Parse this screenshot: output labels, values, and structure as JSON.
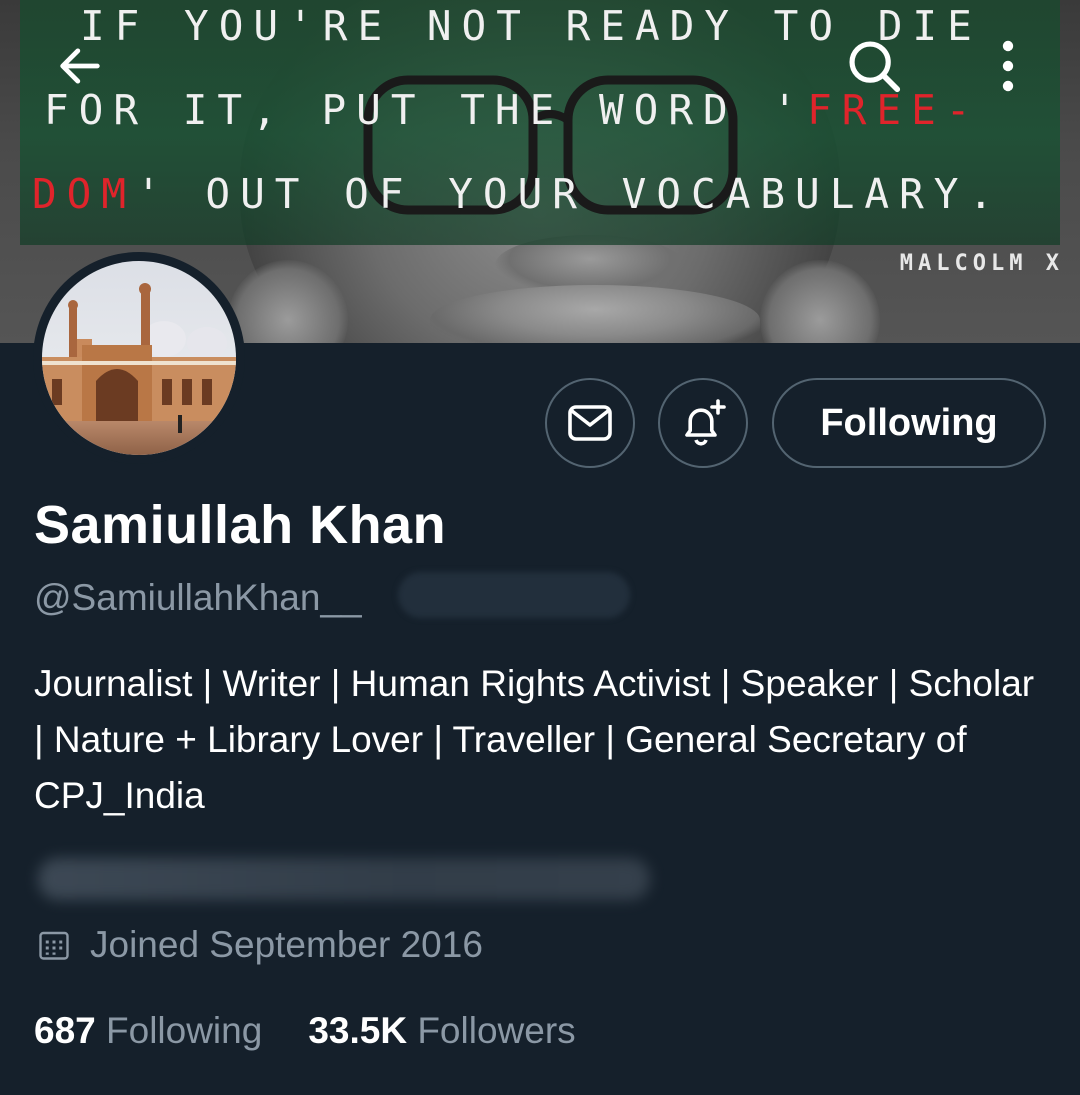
{
  "banner": {
    "quote_line1": "IF YOU'RE NOT READY TO DIE",
    "quote_line2_a": "FOR IT, PUT THE WORD '",
    "quote_line2_b": "FREE-",
    "quote_line3_a": "DOM",
    "quote_line3_b": "' OUT OF YOUR VOCABULARY.",
    "attribution": "MALCOLM X",
    "highlight_color": "#e0242b"
  },
  "nav": {
    "back_icon": "arrow-left-icon",
    "search_icon": "search-icon",
    "more_icon": "more-vertical-icon"
  },
  "actions": {
    "message_icon": "mail-icon",
    "notify_icon": "bell-plus-icon",
    "following_label": "Following"
  },
  "profile": {
    "name": "Samiullah Khan",
    "handle": "@SamiullahKhan__",
    "bio": "Journalist | Writer | Human Rights Activist | Speaker | Scholar | Nature + Library Lover | Traveller | General Secretary of CPJ_India",
    "joined": "Joined September 2016",
    "following_count": "687",
    "following_label": "Following",
    "followers_count": "33.5K",
    "followers_label": "Followers"
  },
  "colors": {
    "background": "#15202b",
    "secondary_text": "#8b98a5",
    "border": "#536471"
  }
}
